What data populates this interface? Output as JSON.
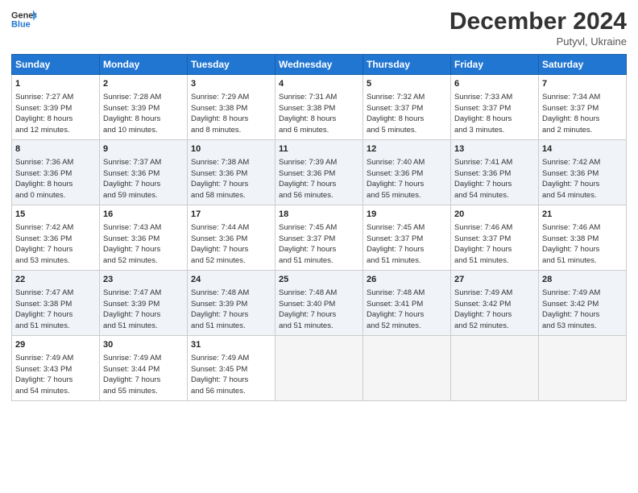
{
  "header": {
    "logo_line1": "General",
    "logo_line2": "Blue",
    "title": "December 2024",
    "subtitle": "Putyvl, Ukraine"
  },
  "days_of_week": [
    "Sunday",
    "Monday",
    "Tuesday",
    "Wednesday",
    "Thursday",
    "Friday",
    "Saturday"
  ],
  "weeks": [
    [
      {
        "day": "1",
        "lines": [
          "Sunrise: 7:27 AM",
          "Sunset: 3:39 PM",
          "Daylight: 8 hours",
          "and 12 minutes."
        ]
      },
      {
        "day": "2",
        "lines": [
          "Sunrise: 7:28 AM",
          "Sunset: 3:39 PM",
          "Daylight: 8 hours",
          "and 10 minutes."
        ]
      },
      {
        "day": "3",
        "lines": [
          "Sunrise: 7:29 AM",
          "Sunset: 3:38 PM",
          "Daylight: 8 hours",
          "and 8 minutes."
        ]
      },
      {
        "day": "4",
        "lines": [
          "Sunrise: 7:31 AM",
          "Sunset: 3:38 PM",
          "Daylight: 8 hours",
          "and 6 minutes."
        ]
      },
      {
        "day": "5",
        "lines": [
          "Sunrise: 7:32 AM",
          "Sunset: 3:37 PM",
          "Daylight: 8 hours",
          "and 5 minutes."
        ]
      },
      {
        "day": "6",
        "lines": [
          "Sunrise: 7:33 AM",
          "Sunset: 3:37 PM",
          "Daylight: 8 hours",
          "and 3 minutes."
        ]
      },
      {
        "day": "7",
        "lines": [
          "Sunrise: 7:34 AM",
          "Sunset: 3:37 PM",
          "Daylight: 8 hours",
          "and 2 minutes."
        ]
      }
    ],
    [
      {
        "day": "8",
        "lines": [
          "Sunrise: 7:36 AM",
          "Sunset: 3:36 PM",
          "Daylight: 8 hours",
          "and 0 minutes."
        ]
      },
      {
        "day": "9",
        "lines": [
          "Sunrise: 7:37 AM",
          "Sunset: 3:36 PM",
          "Daylight: 7 hours",
          "and 59 minutes."
        ]
      },
      {
        "day": "10",
        "lines": [
          "Sunrise: 7:38 AM",
          "Sunset: 3:36 PM",
          "Daylight: 7 hours",
          "and 58 minutes."
        ]
      },
      {
        "day": "11",
        "lines": [
          "Sunrise: 7:39 AM",
          "Sunset: 3:36 PM",
          "Daylight: 7 hours",
          "and 56 minutes."
        ]
      },
      {
        "day": "12",
        "lines": [
          "Sunrise: 7:40 AM",
          "Sunset: 3:36 PM",
          "Daylight: 7 hours",
          "and 55 minutes."
        ]
      },
      {
        "day": "13",
        "lines": [
          "Sunrise: 7:41 AM",
          "Sunset: 3:36 PM",
          "Daylight: 7 hours",
          "and 54 minutes."
        ]
      },
      {
        "day": "14",
        "lines": [
          "Sunrise: 7:42 AM",
          "Sunset: 3:36 PM",
          "Daylight: 7 hours",
          "and 54 minutes."
        ]
      }
    ],
    [
      {
        "day": "15",
        "lines": [
          "Sunrise: 7:42 AM",
          "Sunset: 3:36 PM",
          "Daylight: 7 hours",
          "and 53 minutes."
        ]
      },
      {
        "day": "16",
        "lines": [
          "Sunrise: 7:43 AM",
          "Sunset: 3:36 PM",
          "Daylight: 7 hours",
          "and 52 minutes."
        ]
      },
      {
        "day": "17",
        "lines": [
          "Sunrise: 7:44 AM",
          "Sunset: 3:36 PM",
          "Daylight: 7 hours",
          "and 52 minutes."
        ]
      },
      {
        "day": "18",
        "lines": [
          "Sunrise: 7:45 AM",
          "Sunset: 3:37 PM",
          "Daylight: 7 hours",
          "and 51 minutes."
        ]
      },
      {
        "day": "19",
        "lines": [
          "Sunrise: 7:45 AM",
          "Sunset: 3:37 PM",
          "Daylight: 7 hours",
          "and 51 minutes."
        ]
      },
      {
        "day": "20",
        "lines": [
          "Sunrise: 7:46 AM",
          "Sunset: 3:37 PM",
          "Daylight: 7 hours",
          "and 51 minutes."
        ]
      },
      {
        "day": "21",
        "lines": [
          "Sunrise: 7:46 AM",
          "Sunset: 3:38 PM",
          "Daylight: 7 hours",
          "and 51 minutes."
        ]
      }
    ],
    [
      {
        "day": "22",
        "lines": [
          "Sunrise: 7:47 AM",
          "Sunset: 3:38 PM",
          "Daylight: 7 hours",
          "and 51 minutes."
        ]
      },
      {
        "day": "23",
        "lines": [
          "Sunrise: 7:47 AM",
          "Sunset: 3:39 PM",
          "Daylight: 7 hours",
          "and 51 minutes."
        ]
      },
      {
        "day": "24",
        "lines": [
          "Sunrise: 7:48 AM",
          "Sunset: 3:39 PM",
          "Daylight: 7 hours",
          "and 51 minutes."
        ]
      },
      {
        "day": "25",
        "lines": [
          "Sunrise: 7:48 AM",
          "Sunset: 3:40 PM",
          "Daylight: 7 hours",
          "and 51 minutes."
        ]
      },
      {
        "day": "26",
        "lines": [
          "Sunrise: 7:48 AM",
          "Sunset: 3:41 PM",
          "Daylight: 7 hours",
          "and 52 minutes."
        ]
      },
      {
        "day": "27",
        "lines": [
          "Sunrise: 7:49 AM",
          "Sunset: 3:42 PM",
          "Daylight: 7 hours",
          "and 52 minutes."
        ]
      },
      {
        "day": "28",
        "lines": [
          "Sunrise: 7:49 AM",
          "Sunset: 3:42 PM",
          "Daylight: 7 hours",
          "and 53 minutes."
        ]
      }
    ],
    [
      {
        "day": "29",
        "lines": [
          "Sunrise: 7:49 AM",
          "Sunset: 3:43 PM",
          "Daylight: 7 hours",
          "and 54 minutes."
        ]
      },
      {
        "day": "30",
        "lines": [
          "Sunrise: 7:49 AM",
          "Sunset: 3:44 PM",
          "Daylight: 7 hours",
          "and 55 minutes."
        ]
      },
      {
        "day": "31",
        "lines": [
          "Sunrise: 7:49 AM",
          "Sunset: 3:45 PM",
          "Daylight: 7 hours",
          "and 56 minutes."
        ]
      },
      null,
      null,
      null,
      null
    ]
  ]
}
